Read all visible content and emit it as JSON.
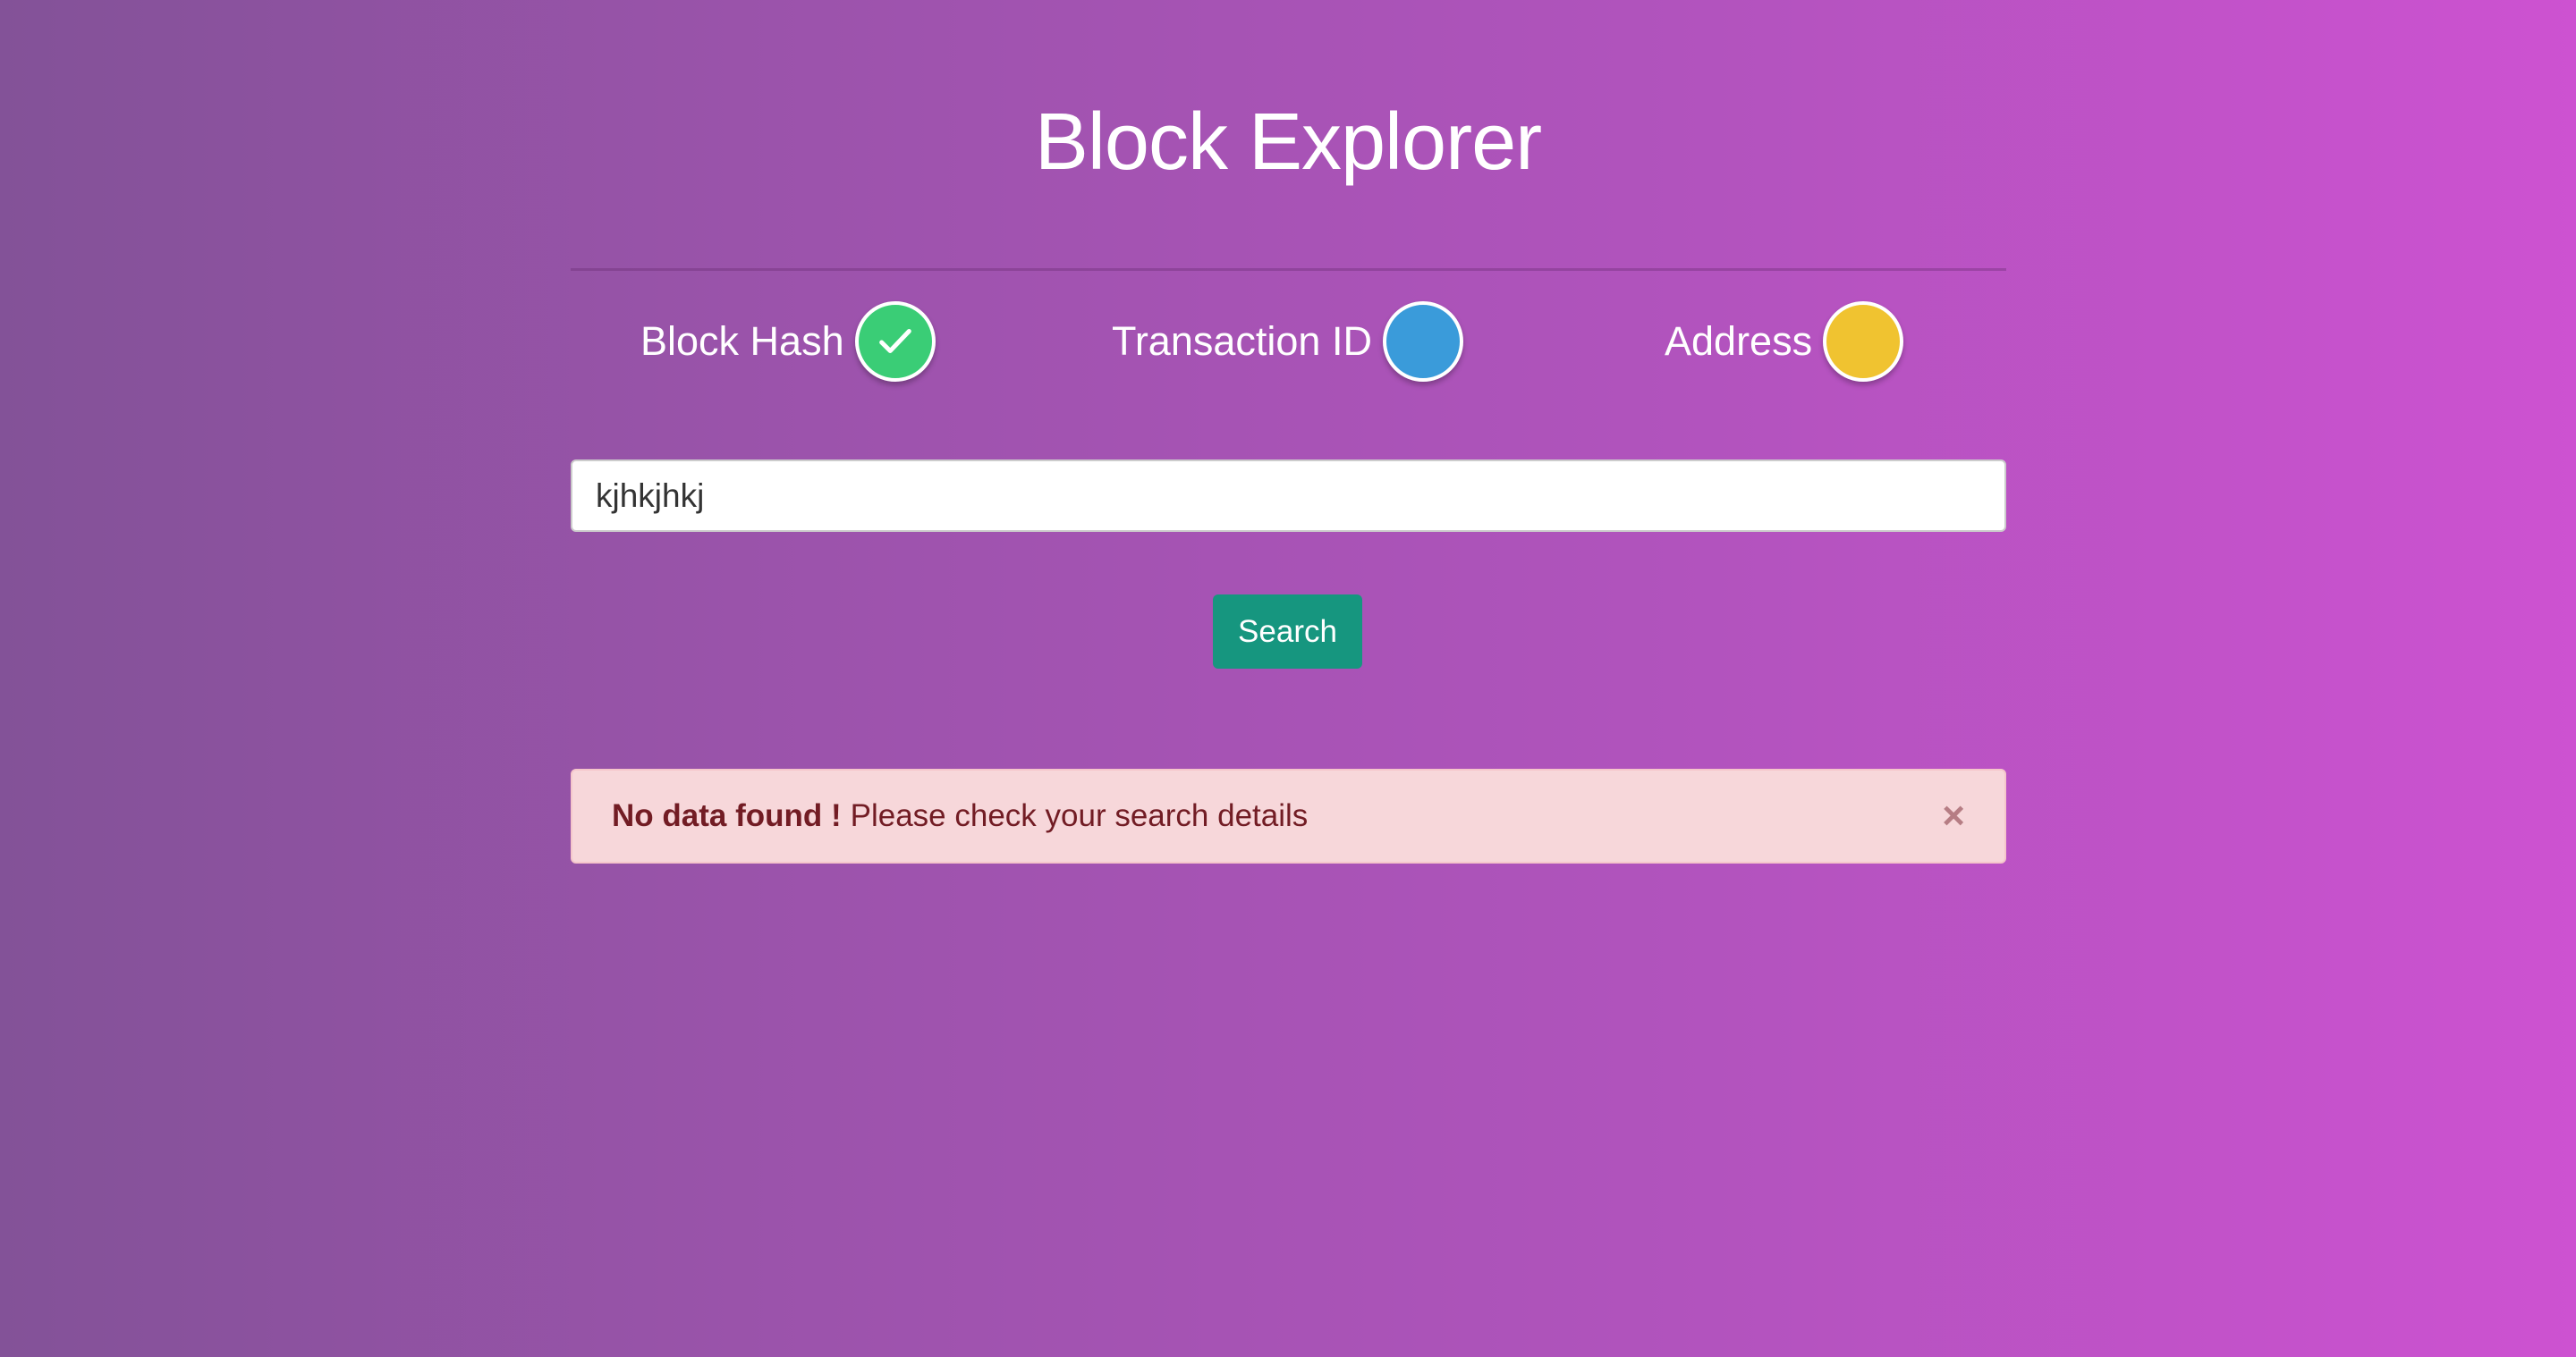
{
  "header": {
    "title": "Block Explorer"
  },
  "search_types": [
    {
      "label": "Block Hash",
      "color": "#3acd76",
      "selected": true
    },
    {
      "label": "Transaction ID",
      "color": "#3a9bda",
      "selected": false
    },
    {
      "label": "Address",
      "color": "#f0c330",
      "selected": false
    }
  ],
  "search": {
    "value": "kjhkjhkj",
    "button_label": "Search"
  },
  "alert": {
    "strong": "No data found !",
    "message": "Please check your search details",
    "close": "×"
  }
}
